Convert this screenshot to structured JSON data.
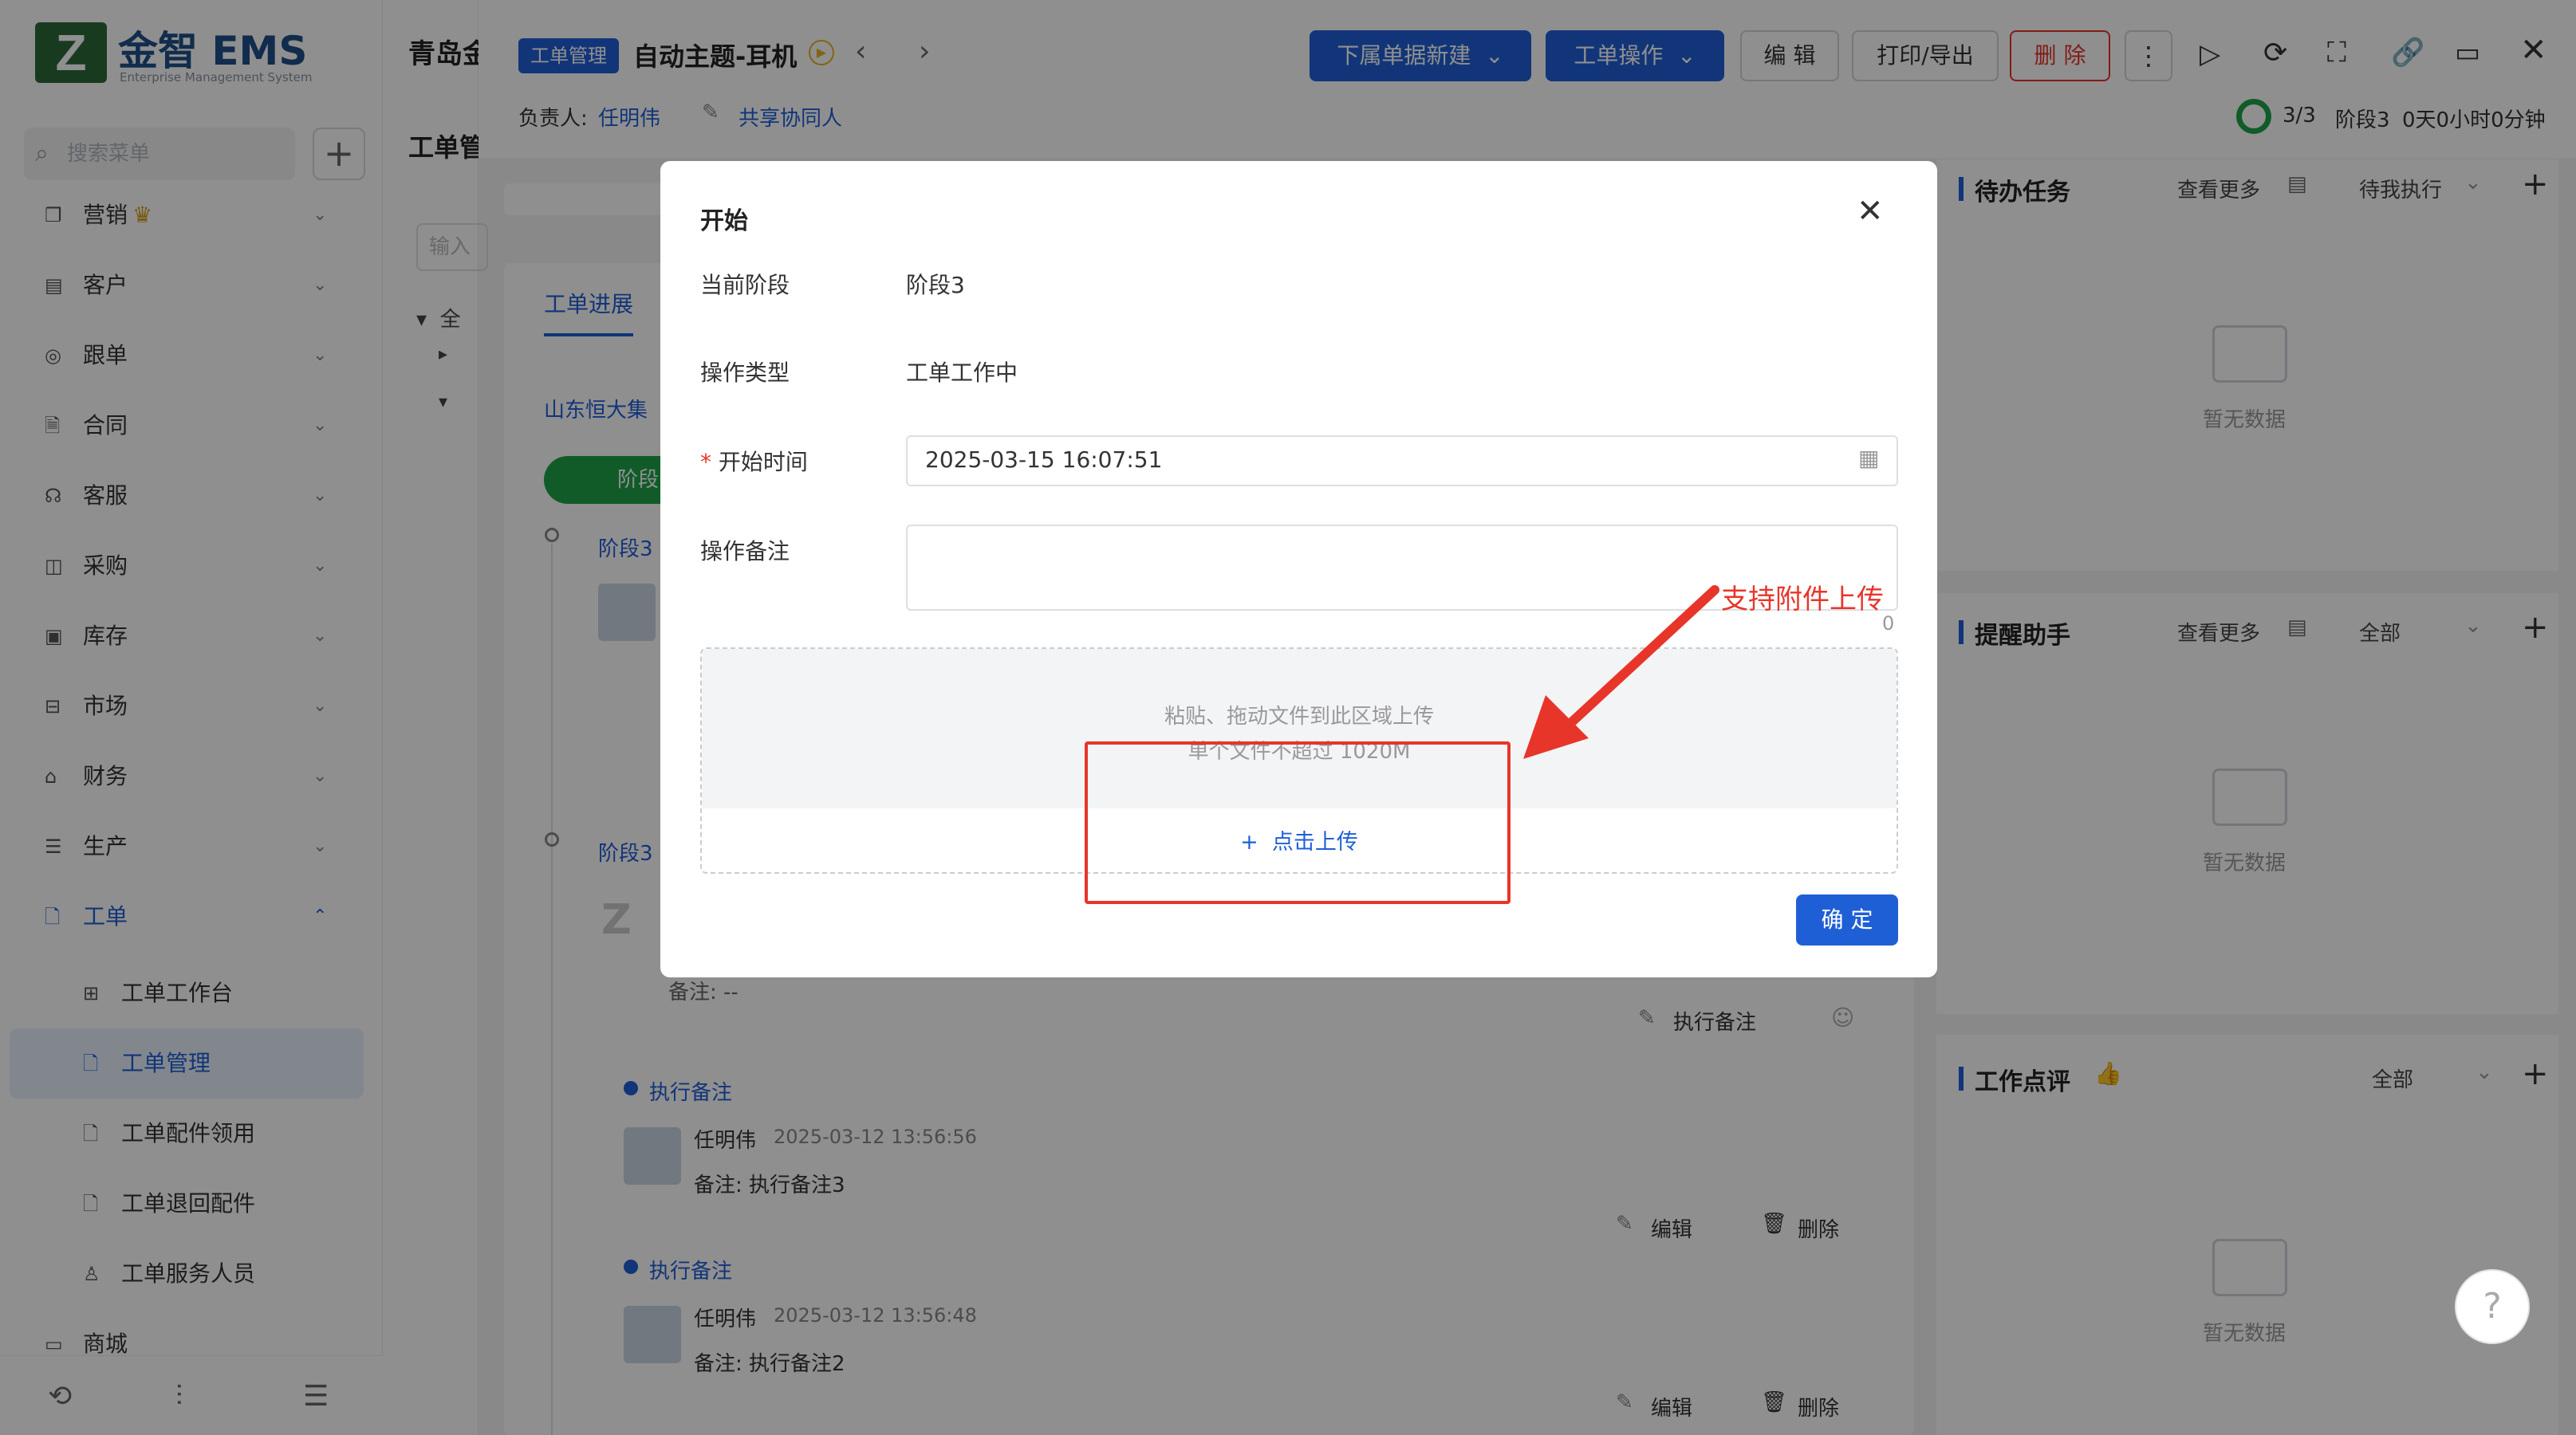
{
  "brand": {
    "logo_text": "金智 EMS",
    "logo_sub": "Enterprise Management System"
  },
  "sidebar": {
    "search_placeholder": "搜索菜单",
    "items": [
      {
        "label": "营销",
        "icon": "copy-icon"
      },
      {
        "label": "客户",
        "icon": "chart-icon"
      },
      {
        "label": "跟单",
        "icon": "target-icon"
      },
      {
        "label": "合同",
        "icon": "doc-search-icon"
      },
      {
        "label": "客服",
        "icon": "headset-icon"
      },
      {
        "label": "采购",
        "icon": "bag-icon"
      },
      {
        "label": "库存",
        "icon": "box-icon"
      },
      {
        "label": "市场",
        "icon": "bookmark-icon"
      },
      {
        "label": "财务",
        "icon": "bank-icon"
      },
      {
        "label": "生产",
        "icon": "factory-icon"
      },
      {
        "label": "工单",
        "icon": "ticket-icon"
      }
    ],
    "subitems": [
      {
        "label": "工单工作台"
      },
      {
        "label": "工单管理"
      },
      {
        "label": "工单配件领用"
      },
      {
        "label": "工单退回配件"
      },
      {
        "label": "工单服务人员"
      },
      {
        "label": "商城"
      }
    ]
  },
  "col2": {
    "title": "青岛金",
    "subtitle": "工单管",
    "input_placeholder": "输入",
    "tree_all": "全"
  },
  "header": {
    "tag": "工单管理",
    "title": "自动主题-耳机",
    "owner_label": "负责人:",
    "owner_name": "任明伟",
    "share_label": "共享协同人",
    "btn_sub_new": "下属单据新建",
    "btn_ops": "工单操作",
    "btn_edit": "编 辑",
    "btn_print": "打印/导出",
    "btn_delete": "删 除",
    "progress": "3/3",
    "stage": "阶段3",
    "elapsed": "0天0小时0分钟"
  },
  "main": {
    "tab": "工单进展",
    "company": "山东恒大集",
    "stage_pill": "阶段",
    "stage_a": "阶段3",
    "stage_b": "阶段3",
    "note_empty": "备注: --",
    "exec_note_btn": "执行备注",
    "entries": [
      {
        "type": "执行备注",
        "user": "任明伟",
        "time": "2025-03-12 13:56:56",
        "note": "备注: 执行备注3",
        "edit": "编辑",
        "delete": "删除"
      },
      {
        "type": "执行备注",
        "user": "任明伟",
        "time": "2025-03-12 13:56:48",
        "note": "备注: 执行备注2",
        "edit": "编辑",
        "delete": "删除"
      }
    ]
  },
  "right": {
    "panels": [
      {
        "title": "待办任务",
        "more": "查看更多",
        "filter": "待我执行",
        "empty": "暂无数据"
      },
      {
        "title": "提醒助手",
        "more": "查看更多",
        "filter": "全部",
        "empty": "暂无数据"
      },
      {
        "title": "工作点评",
        "filter": "全部",
        "empty": "暂无数据"
      }
    ]
  },
  "modal": {
    "title": "开始",
    "current_stage_label": "当前阶段",
    "current_stage_value": "阶段3",
    "op_type_label": "操作类型",
    "op_type_value": "工单工作中",
    "start_time_label": "开始时间",
    "start_time_value": "2025-03-15 16:07:51",
    "remark_label": "操作备注",
    "remark_count": "0",
    "upload_hint1": "粘贴、拖动文件到此区域上传",
    "upload_hint2": "单个文件不超过 1020M",
    "upload_btn": "点击上传",
    "confirm": "确 定"
  },
  "annotation": {
    "text": "支持附件上传",
    "color": "#e8352a"
  },
  "colors": {
    "primary": "#1f5fd6",
    "danger": "#e8352a",
    "success": "#1fa34a"
  }
}
